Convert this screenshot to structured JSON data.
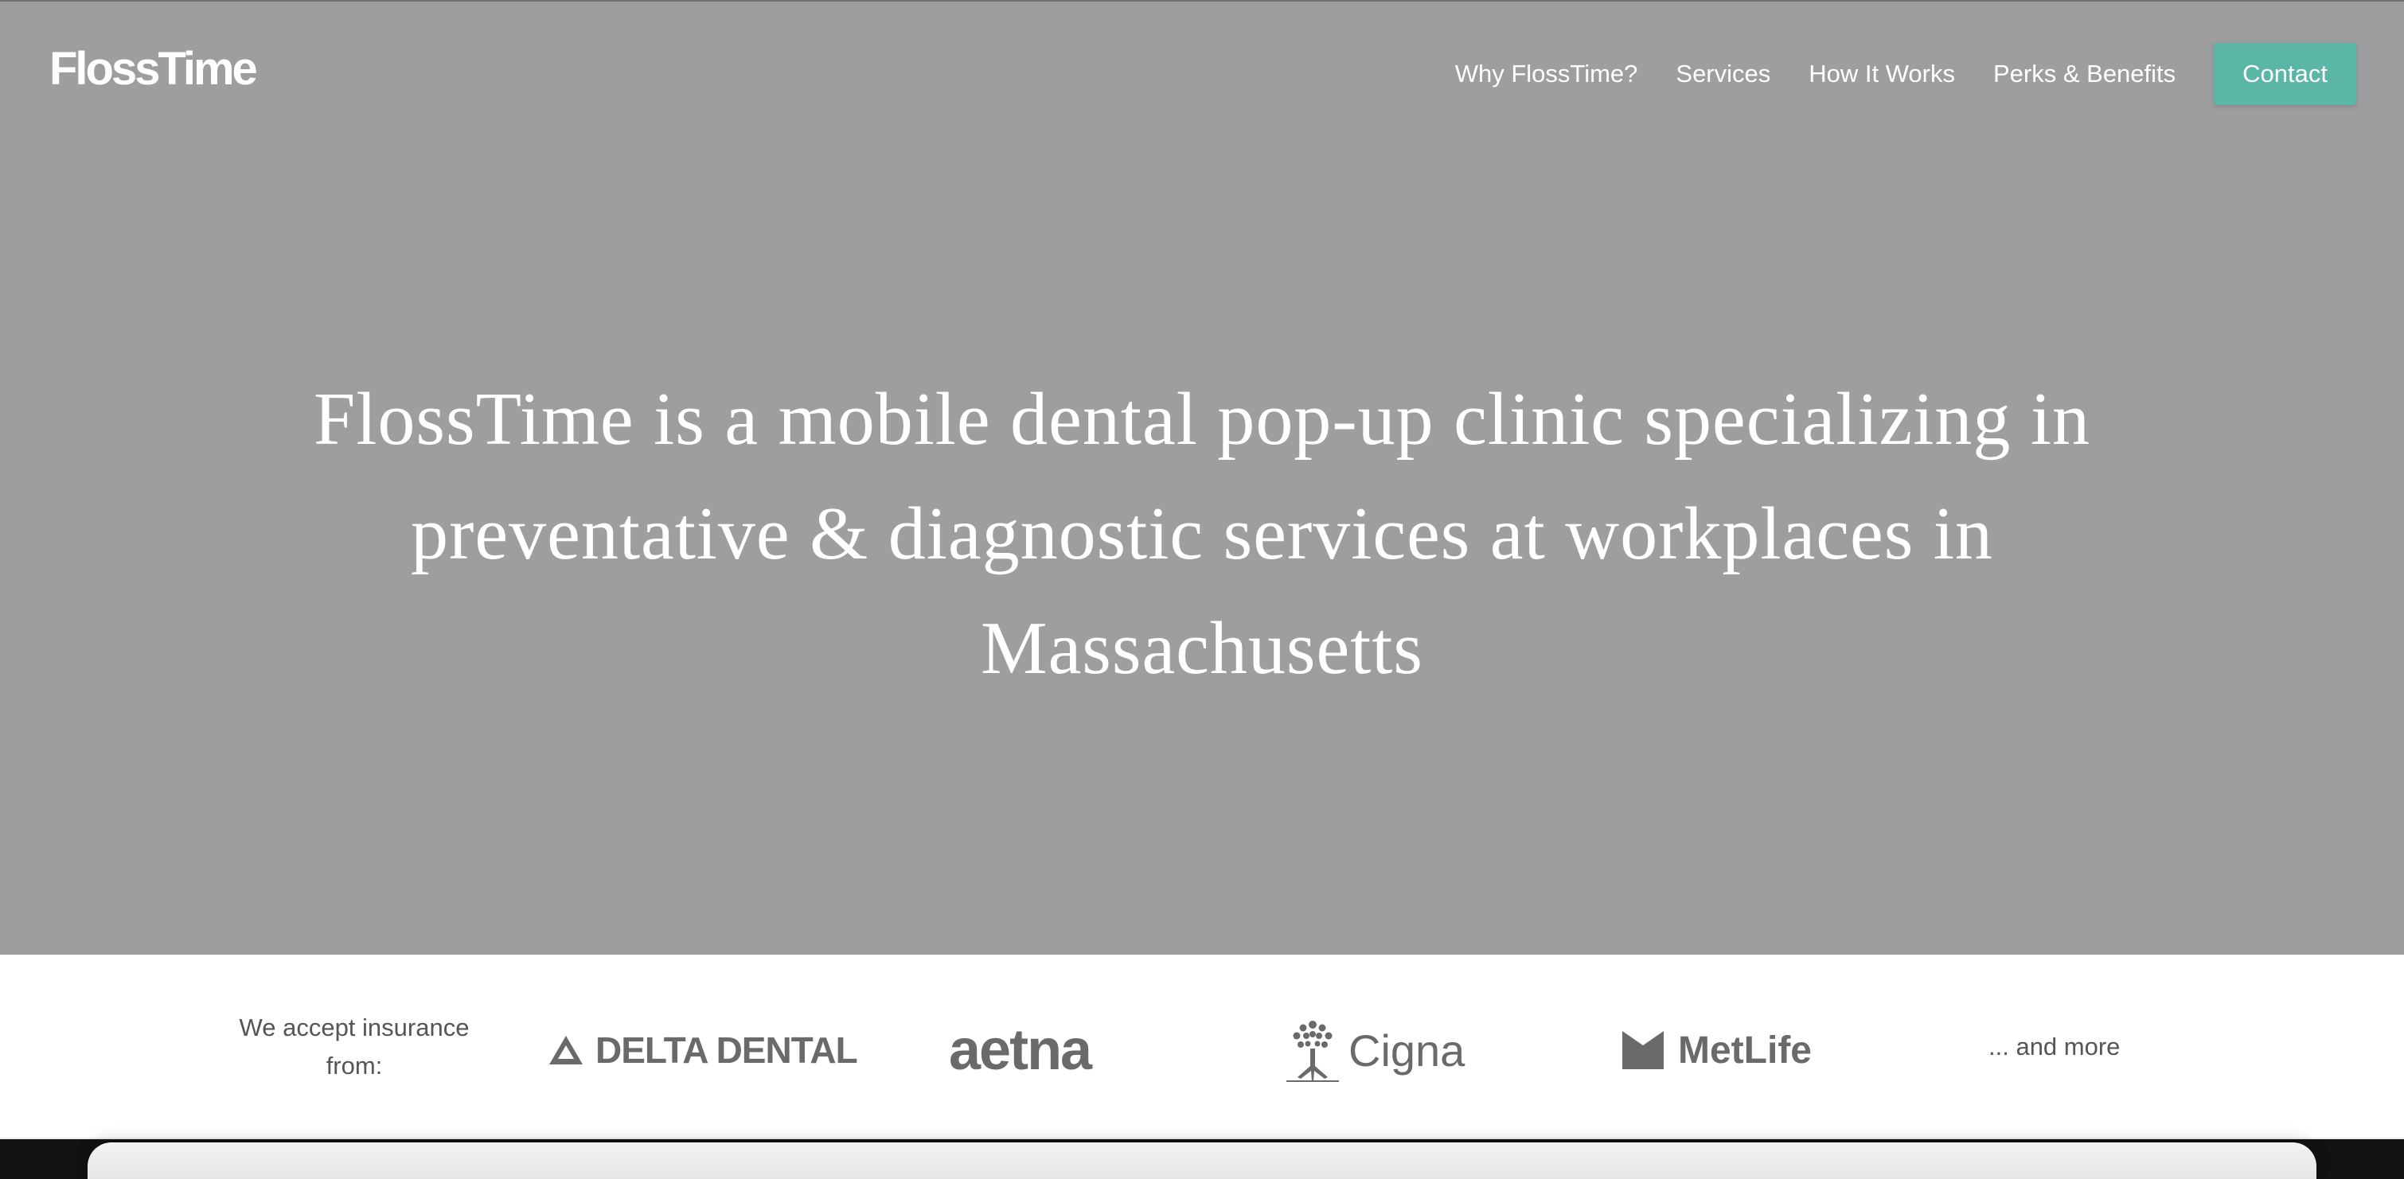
{
  "header": {
    "logo_text": "FlossTime",
    "nav": [
      "Why FlossTime?",
      "Services",
      "How It Works",
      "Perks & Benefits"
    ],
    "contact_label": "Contact"
  },
  "hero": {
    "headline": "FlossTime is a mobile dental pop-up clinic specializing in preventative & diagnostic services at workplaces in Massachusetts"
  },
  "insurance": {
    "label": "We accept insurance from:",
    "logos": [
      "DELTA DENTAL",
      "aetna",
      "Cigna",
      "MetLife"
    ],
    "more_text": "... and more"
  },
  "colors": {
    "hero_bg": "#9e9ea0",
    "accent": "#5cb6a7",
    "text_light": "#ffffff",
    "logo_gray": "#6a6a6a"
  }
}
